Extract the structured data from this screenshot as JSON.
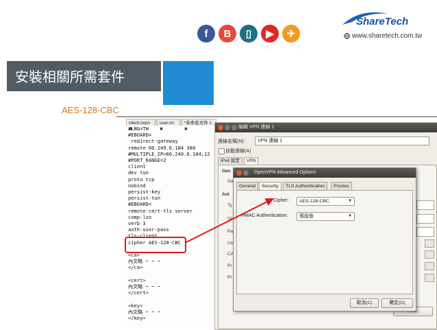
{
  "header": {
    "site_url": "www.sharetech.com.tw",
    "logo_text": "ShareTech",
    "social": [
      {
        "name": "facebook-icon",
        "glyph": "f",
        "color": "#3b5998"
      },
      {
        "name": "blog-icon",
        "glyph": "B",
        "color": "#e8493a"
      },
      {
        "name": "mobile-icon",
        "glyph": "▯",
        "color": "#1d6f86"
      },
      {
        "name": "youtube-icon",
        "glyph": "▶",
        "color": "#e02a20"
      },
      {
        "name": "send-icon",
        "glyph": "✈",
        "color": "#f39a1e"
      }
    ]
  },
  "slide": {
    "title": "安裝相關所需套件",
    "cipher_heading": "AES-128-CBC"
  },
  "editor": {
    "tabs": [
      "client.ovpn ✖",
      "user.crt ✖",
      "*未命名文件 1 ✖"
    ],
    "lines": [
      "#LNG=TW",
      "#EBOARD=",
      " redirect-gateway",
      "remote 60.249.6.184 388",
      "#MULTIPLE_IP=60.249.6.184;12",
      "#PORT_RANGE=2",
      "client",
      "dev tun",
      "proto tcp",
      "nobind",
      "persist-key",
      "persist-tun",
      "#EBOARD=",
      "remote-cert-tls server",
      "comp-lzo",
      "verb 3",
      "auth-user-pass",
      "tls-client",
      "cipher AES-128-CBC",
      "",
      "<ca>",
      "內文略 ~ ~ ~",
      "</ca>",
      "",
      "<cert>",
      "內文略 ~ ~ ~",
      "</cert>",
      "",
      "<key>",
      "內文略 ~ ~ ~",
      "</key>"
    ]
  },
  "network_dialog": {
    "title": "編輯 VPN 連線 1",
    "conn_name_label": "連線名稱(N):",
    "conn_name_value": "VPN 連線 1",
    "auto_connect_label": "自動連線(A)",
    "tabs": [
      "IPv4 設定",
      "VPN"
    ],
    "side_labels": [
      "Gen",
      "Ga",
      "Aut",
      "Ty",
      "Us",
      "Pa",
      "Us",
      "CA",
      "Pr",
      "Pr"
    ],
    "advanced_button": "...ed..."
  },
  "advanced_dialog": {
    "title": "OpenVPN Advanced Options",
    "tabs": [
      "General",
      "Security",
      "TLS Authentication",
      "Proxies"
    ],
    "cipher_label": "Cipher:",
    "cipher_value": "AES-128-CBC",
    "hmac_label": "HMAC Authentication:",
    "hmac_value": "預設值",
    "cancel_label": "取消(C)",
    "ok_label": "確定(O)"
  }
}
